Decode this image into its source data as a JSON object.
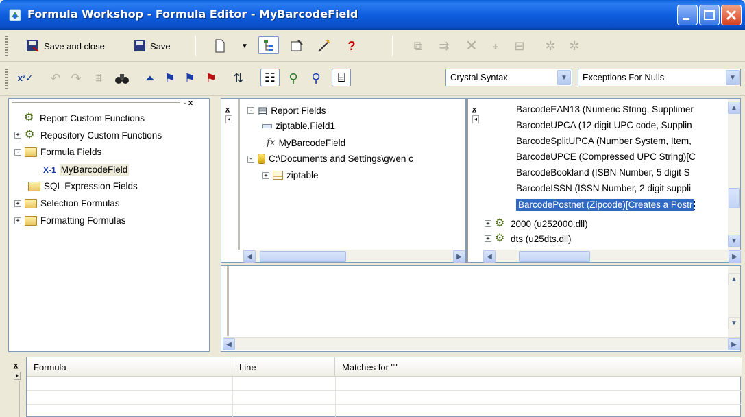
{
  "window": {
    "title": "Formula Workshop - Formula Editor - MyBarcodeField"
  },
  "toolbar1": {
    "save_close_label": "Save and close",
    "save_label": "Save"
  },
  "toolbar2": {
    "syntax_select": "Crystal Syntax",
    "nulls_select": "Exceptions For Nulls"
  },
  "workshop_tree": [
    {
      "label": "Report Custom Functions",
      "expander": "",
      "icon": "gear-icon"
    },
    {
      "label": "Repository Custom Functions",
      "expander": "+",
      "icon": "gear-icon"
    },
    {
      "label": "Formula Fields",
      "expander": "-",
      "icon": "folder-icon"
    },
    {
      "label": "MyBarcodeField",
      "expander": "",
      "icon": "formula-icon"
    },
    {
      "label": "SQL Expression Fields",
      "expander": "",
      "icon": "folder-icon"
    },
    {
      "label": "Selection Formulas",
      "expander": "+",
      "icon": "folder-icon"
    },
    {
      "label": "Formatting Formulas",
      "expander": "+",
      "icon": "folder-icon"
    }
  ],
  "fields_tree": [
    {
      "label": "Report Fields",
      "expander": "-",
      "icon": "report-icon"
    },
    {
      "label": "ziptable.Field1",
      "expander": "",
      "icon": "field-icon"
    },
    {
      "label": "MyBarcodeField",
      "expander": "",
      "icon": "fx-icon"
    },
    {
      "label": "C:\\Documents and Settings\\gwen c",
      "expander": "-",
      "icon": "database-icon"
    },
    {
      "label": "ziptable",
      "expander": "+",
      "icon": "table-icon"
    }
  ],
  "functions_list": [
    "BarcodeEAN13 (Numeric String, Supplimer",
    "BarcodeUPCA (12 digit UPC code, Supplin",
    "BarcodeSplitUPCA (Number System, Item,",
    "BarcodeUPCE (Compressed UPC String)[C",
    "BarcodeBookland (ISBN Number, 5 digit S",
    "BarcodeISSN (ISSN Number, 2 digit suppli",
    "BarcodePostnet (Zipcode)[Creates a Postr"
  ],
  "functions_dlls": [
    "2000 (u252000.dll)",
    "dts (u25dts.dll)"
  ],
  "results_table": {
    "columns": [
      "Formula",
      "Line",
      "Matches for \"\""
    ]
  }
}
